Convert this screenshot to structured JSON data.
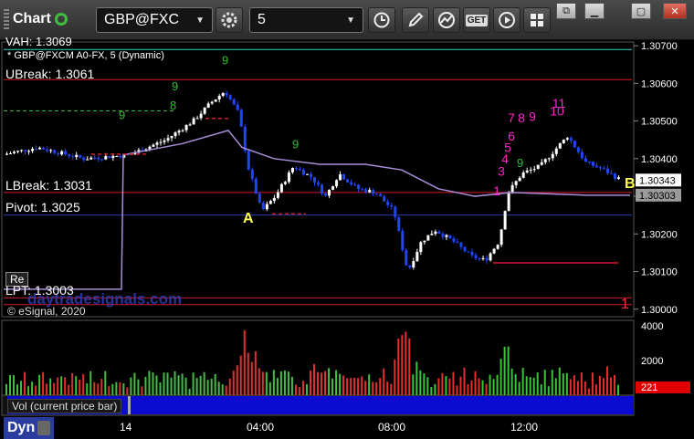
{
  "toolbar": {
    "title": "Chart",
    "symbol": "GBP@FXC",
    "interval": "5",
    "buttons": [
      {
        "name": "gear-icon"
      },
      {
        "name": "clock-icon"
      },
      {
        "name": "pencil-icon"
      },
      {
        "name": "study-icon"
      },
      {
        "name": "get-icon",
        "label": "GET"
      },
      {
        "name": "play-icon"
      },
      {
        "name": "grid-icon"
      }
    ]
  },
  "legend": {
    "top_cut": "VAH: 1.3069",
    "series_label": "* GBP@FXCM A0-FX, 5 (Dynamic)",
    "ubreak": "UBreak: 1.3061",
    "lbreak": "LBreak: 1.3031",
    "pivot": "Pivot: 1.3025",
    "lpt": "LPT: 1.3003",
    "watermark": "daytradesignals.com",
    "copyright": "© eSignal, 2020",
    "re_label": "Re",
    "label_a": "A",
    "label_b": "B",
    "label_one": "1"
  },
  "colors": {
    "resistance": "#d11a2a",
    "support_line": "#2a3ea8",
    "vwap": "#a88ed8",
    "up_bar": "#ffffff",
    "down_bar": "#2244ff",
    "td_count": "#ff22cc",
    "green_count": "#2fbf2f",
    "label_yellow": "#ffff55",
    "volume_up": "#3fc03f",
    "volume_down": "#e03030"
  },
  "chart_data": {
    "type": "candlestick",
    "title": "GBP@FXCM A0-FX, 5 (Dynamic)",
    "y_ticks": [
      "1.30700",
      "1.30600",
      "1.30500",
      "1.30400",
      "1.30300",
      "1.30200",
      "1.30100",
      "1.30000"
    ],
    "ylim": [
      1.2998,
      1.3071
    ],
    "price_tags": [
      {
        "value": "1.30343",
        "y": 1.30343,
        "bg": "#ffffff",
        "fg": "#000000"
      },
      {
        "value": "1.30303",
        "y": 1.30303,
        "bg": "#9a9a9a",
        "fg": "#000000"
      }
    ],
    "x_ticks": [
      "14",
      "04:00",
      "08:00",
      "12:00"
    ],
    "levels": [
      {
        "name": "VAH",
        "value": 1.3069
      },
      {
        "name": "UBreak",
        "value": 1.3061
      },
      {
        "name": "LBreak",
        "value": 1.3031
      },
      {
        "name": "Pivot",
        "value": 1.3025
      },
      {
        "name": "LPT",
        "value": 1.3003
      }
    ],
    "td_labels": [
      "7",
      "8",
      "9",
      "11",
      "10",
      "6",
      "5",
      "4",
      "3",
      "1"
    ],
    "volume": {
      "ylabel": "Vol (current price bar)",
      "y_ticks": [
        "4000",
        "2000"
      ],
      "current": "221",
      "ylim": [
        0,
        4200
      ]
    }
  }
}
